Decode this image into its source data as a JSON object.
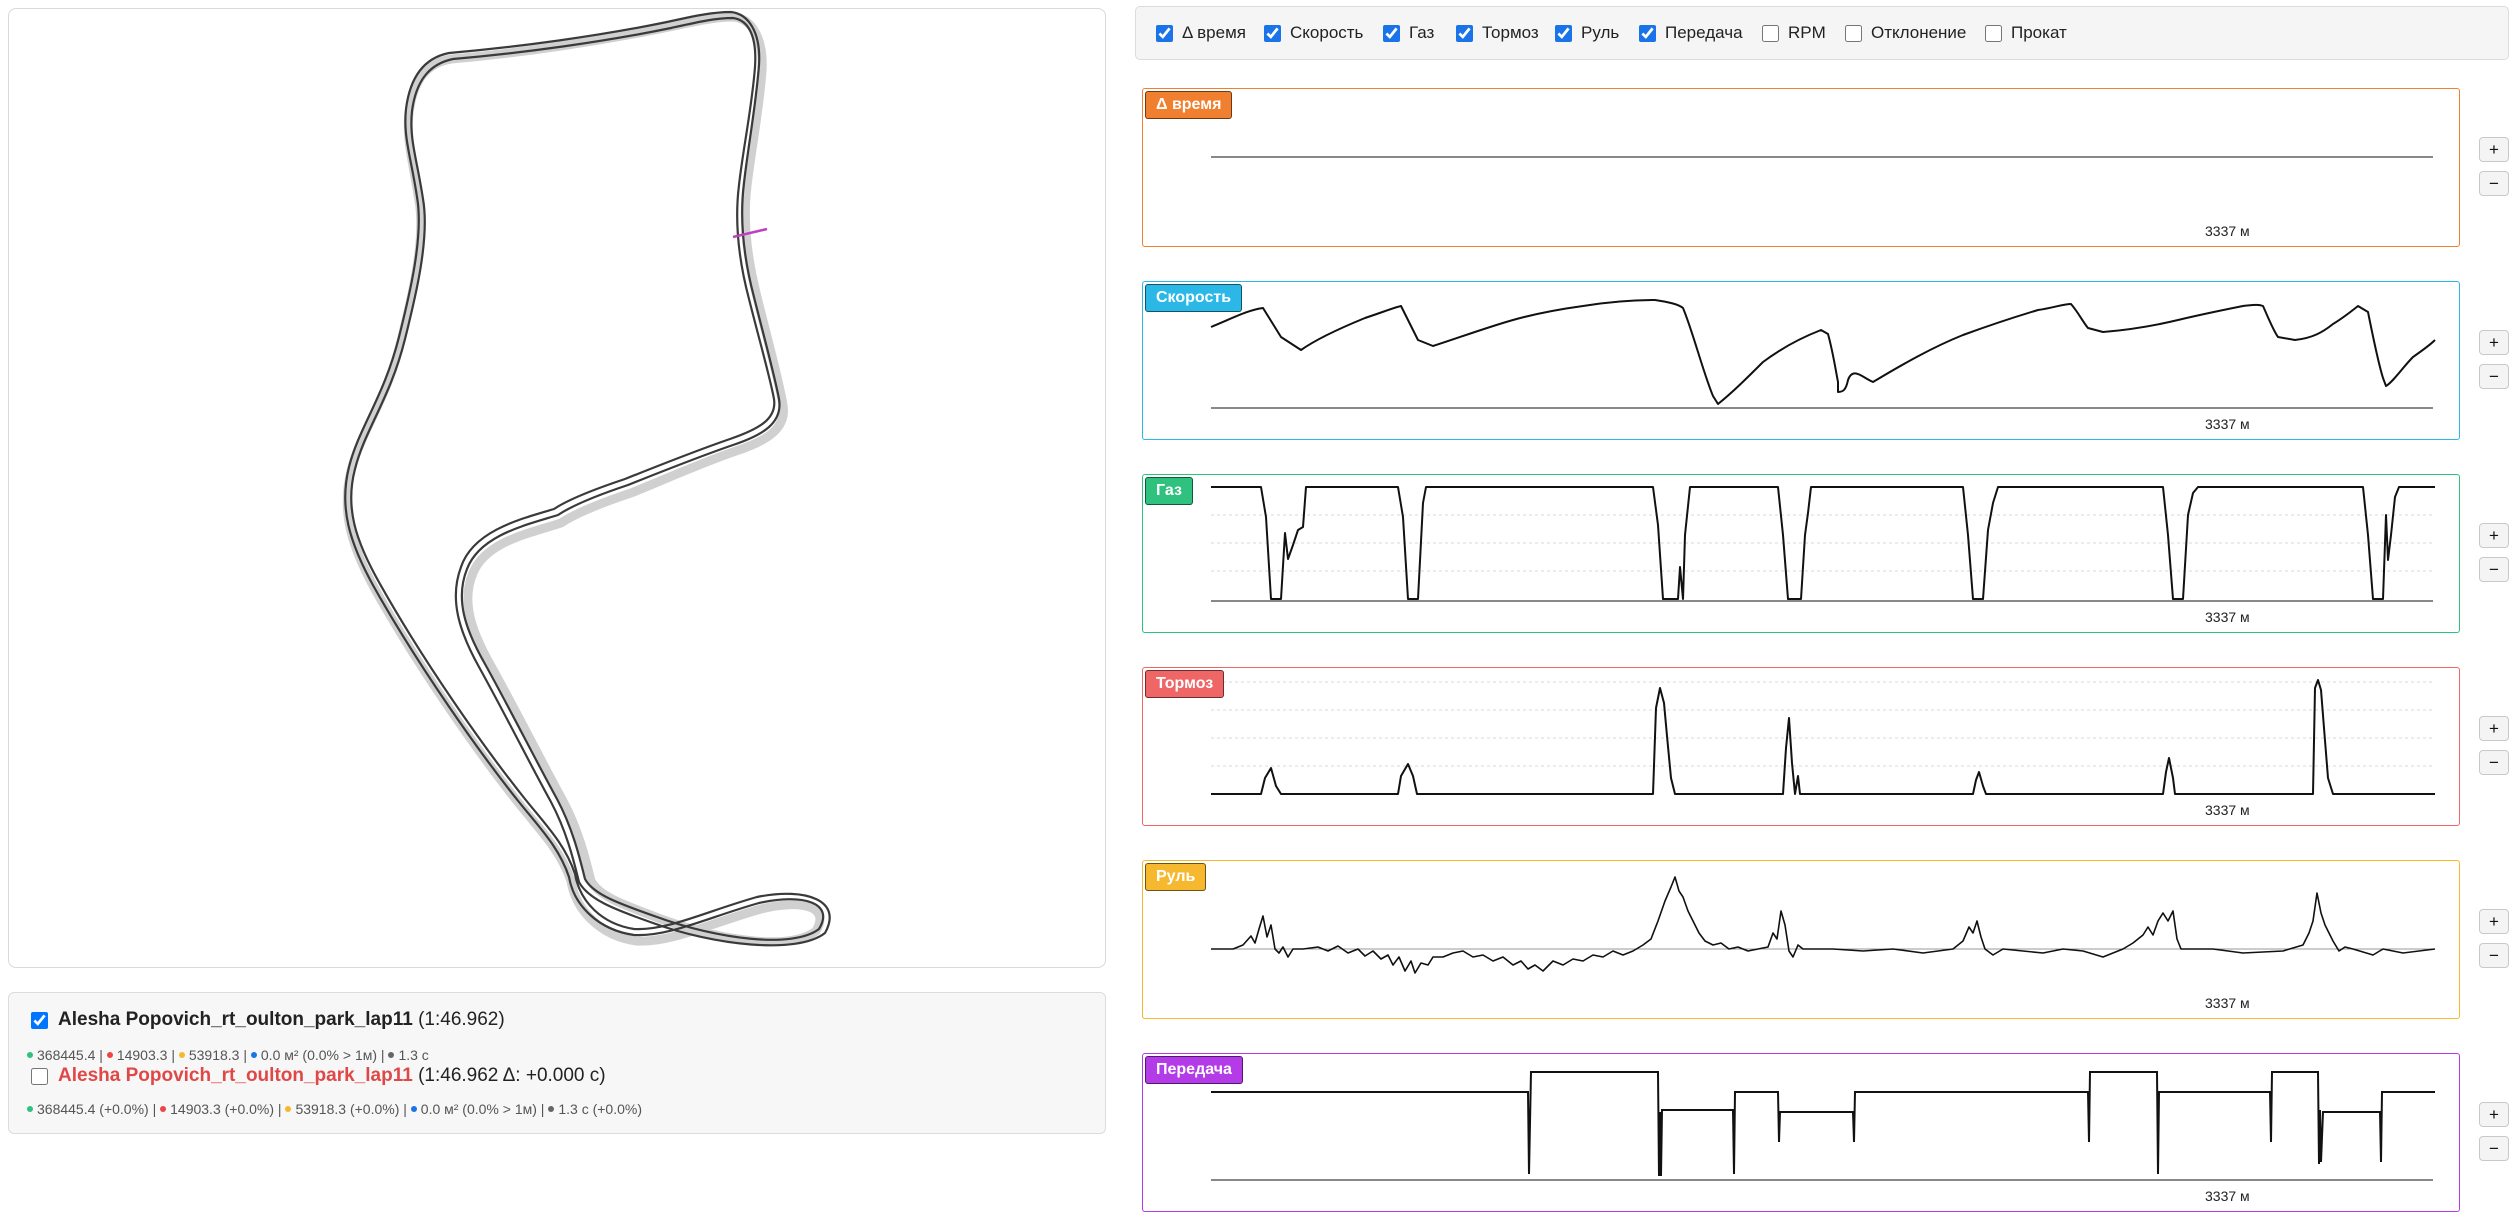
{
  "toolbar": {
    "items": [
      {
        "label": "Δ время",
        "checked": true
      },
      {
        "label": "Скорость",
        "checked": true
      },
      {
        "label": "Газ",
        "checked": true
      },
      {
        "label": "Тормоз",
        "checked": true
      },
      {
        "label": "Руль",
        "checked": true
      },
      {
        "label": "Передача",
        "checked": true
      },
      {
        "label": "RPM",
        "checked": false
      },
      {
        "label": "Отклонение",
        "checked": false
      },
      {
        "label": "Прокат",
        "checked": false
      }
    ]
  },
  "charts": [
    {
      "key": "delta",
      "label": "Δ время",
      "color": "#f08030",
      "distance": "3337 м"
    },
    {
      "key": "speed",
      "label": "Скорость",
      "color": "#2bb8e6",
      "distance": "3337 м"
    },
    {
      "key": "throttle",
      "label": "Газ",
      "color": "#2ec27e",
      "distance": "3337 м"
    },
    {
      "key": "brake",
      "label": "Тормоз",
      "color": "#ee6666",
      "distance": "3337 м"
    },
    {
      "key": "steering",
      "label": "Руль",
      "color": "#f5b82e",
      "distance": "3337 м"
    },
    {
      "key": "gear",
      "label": "Передача",
      "color": "#b43be8",
      "distance": "3337 м"
    }
  ],
  "zoom": {
    "plus": "+",
    "minus": "−"
  },
  "laps": [
    {
      "checked": true,
      "name": "Alesha Popovich_rt_oulton_park_lap11",
      "time": "(1:46.962)",
      "stats": [
        "368445.4",
        "14903.3",
        "53918.3",
        "0.0 м² (0.0% > 1м)",
        "1.3 с"
      ],
      "stat_colors": [
        "#2ec27e",
        "#ee4444",
        "#f5b82e",
        "#1a73e8",
        "#666666"
      ]
    },
    {
      "checked": false,
      "name": "Alesha Popovich_rt_oulton_park_lap11",
      "time": "(1:46.962 Δ: +0.000 с)",
      "stats": [
        "368445.4 (+0.0%)",
        "14903.3 (+0.0%)",
        "53918.3 (+0.0%)",
        "0.0 м² (0.0% > 1м)",
        "1.3 с (+0.0%)"
      ],
      "stat_colors": [
        "#2ec27e",
        "#ee4444",
        "#f5b82e",
        "#1a73e8",
        "#666666"
      ]
    }
  ],
  "track": {
    "line_color": "#333333",
    "shadow_color": "#cccccc",
    "marker_color": "#c040c0"
  }
}
